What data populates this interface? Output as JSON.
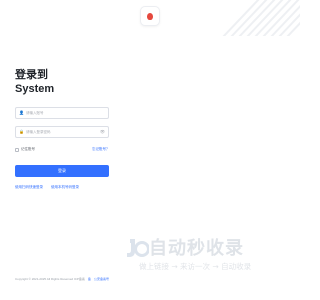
{
  "login": {
    "title_line1": "登录到",
    "title_line2": "System",
    "account_placeholder": "请输入账号",
    "password_placeholder": "请输入登录密码",
    "remember_label": "记住账号",
    "forgot_label": "忘记账号？",
    "submit_label": "登录",
    "link_left": "使用扫码快速登录",
    "link_right": "使用本机号码登录"
  },
  "footer": {
    "copyright": "Copyright © 2021-2025 All Rights Reserved ICP备案",
    "tag1": "备",
    "tag2": "公安备案号"
  },
  "watermark": {
    "main": "自动秒收录",
    "sub": "做上链接 → 来访一次 → 自动收录"
  },
  "colors": {
    "accent": "#3370ff",
    "logo": "#e5483e"
  }
}
